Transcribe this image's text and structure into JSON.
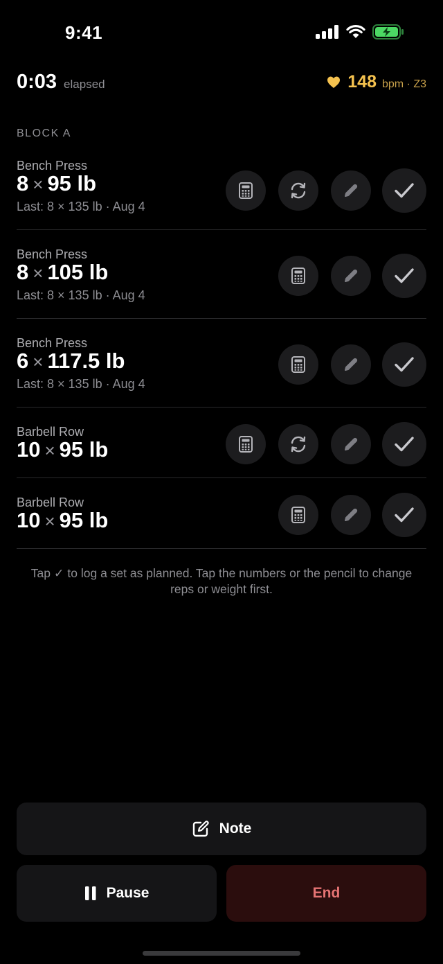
{
  "status": {
    "time": "9:41"
  },
  "header": {
    "elapsed_value": "0:03",
    "elapsed_label": "elapsed",
    "hr_value": "148",
    "hr_unit": "bpm · Z3",
    "accent": "#f5c24f"
  },
  "block": {
    "label": "BLOCK A"
  },
  "sets": [
    {
      "exercise": "Bench Press",
      "reps": "8",
      "weight": "95 lb",
      "last": "Last: 8 × 135 lb · Aug 4",
      "actions": [
        "calculator-icon",
        "swap-icon",
        "pencil-icon",
        "check-icon"
      ]
    },
    {
      "exercise": "Bench Press",
      "reps": "8",
      "weight": "105 lb",
      "last": "Last: 8 × 135 lb · Aug 4",
      "actions": [
        "calculator-icon",
        "pencil-icon",
        "check-icon"
      ]
    },
    {
      "exercise": "Bench Press",
      "reps": "6",
      "weight": "117.5 lb",
      "last": "Last: 8 × 135 lb · Aug 4",
      "actions": [
        "calculator-icon",
        "pencil-icon",
        "check-icon"
      ]
    },
    {
      "exercise": "Barbell Row",
      "reps": "10",
      "weight": "95 lb",
      "last": "",
      "actions": [
        "calculator-icon",
        "swap-icon",
        "pencil-icon",
        "check-icon"
      ]
    },
    {
      "exercise": "Barbell Row",
      "reps": "10",
      "weight": "95 lb",
      "last": "",
      "actions": [
        "calculator-icon",
        "pencil-icon",
        "check-icon"
      ]
    }
  ],
  "times_sign": "×",
  "hint": "Tap ✓ to log a set as planned. Tap the numbers or the pencil to change reps or weight first.",
  "buttons": {
    "note_label": "Note",
    "pause_label": "Pause",
    "end_label": "End",
    "end_color": "#e57373"
  }
}
